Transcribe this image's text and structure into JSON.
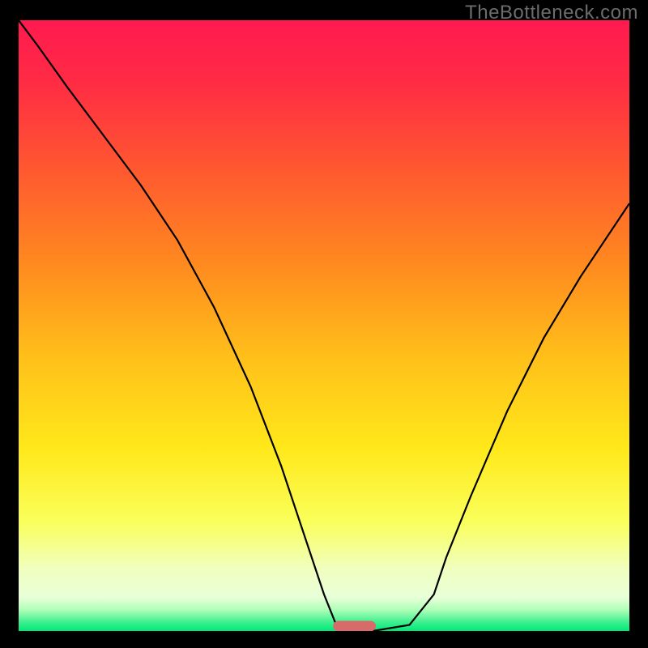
{
  "watermark": "TheBottleneck.com",
  "chart_data": {
    "type": "line",
    "title": "",
    "xlabel": "",
    "ylabel": "",
    "xlim": [
      0,
      100
    ],
    "ylim": [
      0,
      100
    ],
    "x": [
      0,
      3,
      8,
      14,
      20,
      26,
      32,
      38,
      43,
      47,
      50,
      52,
      54,
      58,
      64,
      68,
      70,
      74,
      80,
      86,
      92,
      100
    ],
    "values": [
      100,
      96,
      89,
      81,
      73,
      64,
      53,
      40,
      27,
      15,
      6,
      1,
      0,
      0,
      1,
      6,
      12,
      22,
      36,
      48,
      58,
      70
    ],
    "gradient_stops": [
      {
        "pos": 0.0,
        "color": "#ff1a4f"
      },
      {
        "pos": 0.1,
        "color": "#ff2b44"
      },
      {
        "pos": 0.25,
        "color": "#ff5a2f"
      },
      {
        "pos": 0.4,
        "color": "#ff8a1f"
      },
      {
        "pos": 0.55,
        "color": "#ffbf1a"
      },
      {
        "pos": 0.7,
        "color": "#ffe81a"
      },
      {
        "pos": 0.82,
        "color": "#faff5a"
      },
      {
        "pos": 0.9,
        "color": "#f0ffc0"
      },
      {
        "pos": 0.945,
        "color": "#e8ffd8"
      },
      {
        "pos": 0.965,
        "color": "#b0ffb8"
      },
      {
        "pos": 0.985,
        "color": "#40f090"
      },
      {
        "pos": 1.0,
        "color": "#00e878"
      }
    ],
    "marker": {
      "x": 55,
      "y": 0.8,
      "w": 7,
      "h": 1.7,
      "color": "#d86a6a"
    }
  }
}
